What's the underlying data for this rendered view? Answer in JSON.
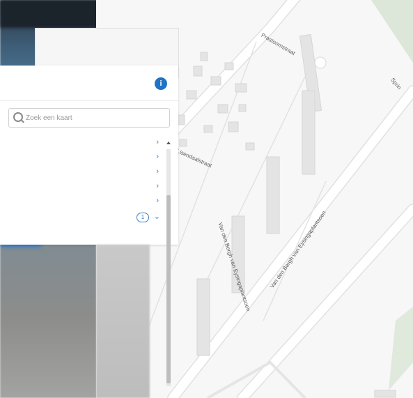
{
  "panel": {
    "info_label": "i",
    "search_placeholder": "Zoek een kaart",
    "items": [
      {
        "label": ""
      },
      {
        "label": ""
      },
      {
        "label": ""
      },
      {
        "label": ""
      },
      {
        "label": ""
      }
    ],
    "expanded_badge": "1"
  },
  "map": {
    "streets": [
      {
        "name": "Prastoornstraat"
      },
      {
        "name": "Lisendaalstraat"
      },
      {
        "name": "Van den Bergh van Eysingaplantsoen"
      },
      {
        "name": "Van den Bergh van Eysingaplantsoen"
      },
      {
        "name": "Sprin"
      }
    ]
  }
}
